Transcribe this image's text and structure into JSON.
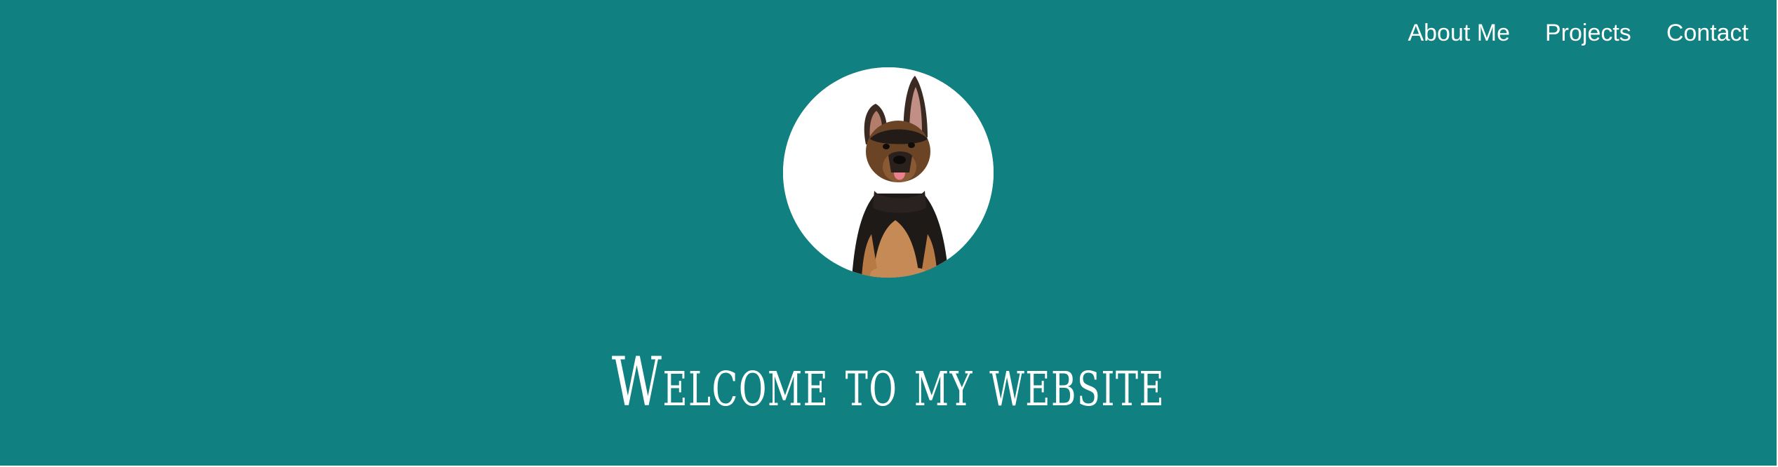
{
  "colors": {
    "background": "#118080",
    "text": "#ffffff",
    "avatar_background": "#ffffff"
  },
  "nav": {
    "items": [
      {
        "label": "About Me"
      },
      {
        "label": "Projects"
      },
      {
        "label": "Contact"
      }
    ]
  },
  "hero": {
    "avatar_icon": "puppy-photo",
    "title": "Welcome to my website"
  }
}
